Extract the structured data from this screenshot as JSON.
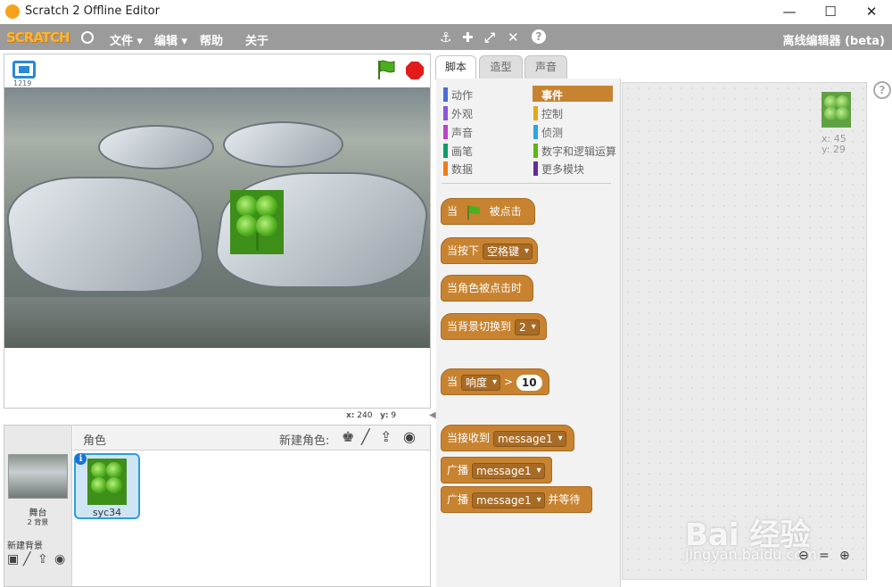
{
  "window": {
    "title": "Scratch 2 Offline Editor",
    "minimize": "—",
    "maximize": "☐",
    "close": "✕"
  },
  "menubar": {
    "logo": "SCRATCH",
    "file": "文件 ▾",
    "edit": "编辑 ▾",
    "help": "帮助",
    "about": "关于",
    "offline_label": "离线编辑器 (beta)",
    "tools": [
      "duplicate-icon",
      "cut-icon",
      "grow-icon",
      "shrink-icon",
      "help-icon"
    ]
  },
  "stage": {
    "version": "1219",
    "mouse_x_label": "x:",
    "mouse_x": "240",
    "mouse_y_label": "y:",
    "mouse_y": "9"
  },
  "sprites_panel": {
    "title": "角色",
    "new_sprite_label": "新建角色:",
    "stage_label": "舞台",
    "backdrop_count": "2 背景",
    "new_backdrop_label": "新建背景",
    "sprites": [
      {
        "name": "syc34",
        "selected": true
      }
    ]
  },
  "tabs": [
    {
      "label": "脚本",
      "active": true
    },
    {
      "label": "造型",
      "active": false
    },
    {
      "label": "声音",
      "active": false
    }
  ],
  "categories": {
    "left": [
      {
        "label": "动作",
        "color": "#4a6cd4"
      },
      {
        "label": "外观",
        "color": "#8a55d7"
      },
      {
        "label": "声音",
        "color": "#bb42c3"
      },
      {
        "label": "画笔",
        "color": "#0e9a6c"
      },
      {
        "label": "数据",
        "color": "#ee7d16"
      }
    ],
    "right": [
      {
        "label": "事件",
        "color": "#c88330",
        "active": true
      },
      {
        "label": "控制",
        "color": "#e1a91a"
      },
      {
        "label": "侦测",
        "color": "#2ca5e2"
      },
      {
        "label": "数字和逻辑运算",
        "color": "#5cb712"
      },
      {
        "label": "更多模块",
        "color": "#632d99"
      }
    ]
  },
  "blocks": {
    "flag_prefix": "当",
    "flag_suffix": "被点击",
    "key_prefix": "当按下",
    "key_value": "空格键",
    "sprite_clicked": "当角色被点击时",
    "backdrop_prefix": "当背景切换到",
    "backdrop_value": "2",
    "sensor_prefix": "当",
    "sensor_value": "响度",
    "sensor_op": ">",
    "sensor_number": "10",
    "receive_prefix": "当接收到",
    "receive_value": "message1",
    "broadcast_prefix": "广播",
    "broadcast_value": "message1",
    "broadcast_wait_prefix": "广播",
    "broadcast_wait_value": "message1",
    "broadcast_wait_suffix": "并等待"
  },
  "script_area": {
    "sprite_x": "x: 45",
    "sprite_y": "y: 29"
  },
  "watermark": {
    "line1": "Bai 经验",
    "line2": "jingyan.baidu.com"
  },
  "colors": {
    "events": "#c88330",
    "menubar": "#9b9b9b",
    "selection": "#2a9de0"
  }
}
